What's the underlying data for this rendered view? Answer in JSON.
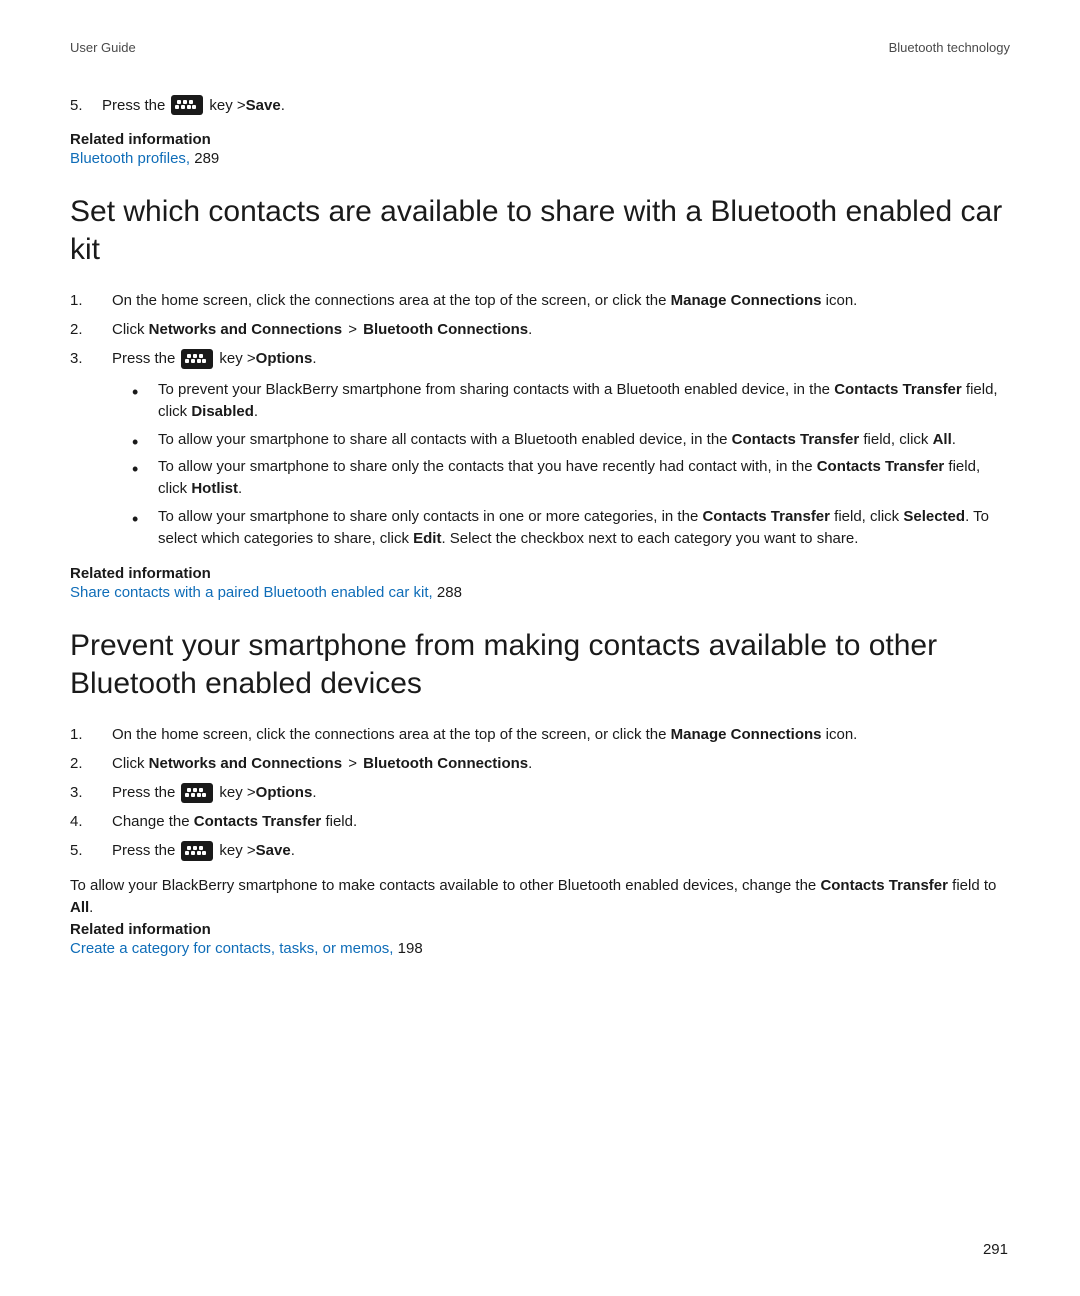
{
  "header": {
    "left": "User Guide",
    "right": "Bluetooth technology"
  },
  "intro_step": {
    "num": "5.",
    "prefix": "Press the ",
    "key_gt": " key > ",
    "action": "Save",
    "period": "."
  },
  "related1": {
    "heading": "Related information",
    "link": "Bluetooth profiles, ",
    "page": "289"
  },
  "section1": {
    "title": "Set which contacts are available to share with a Bluetooth enabled car kit",
    "steps": {
      "s1": {
        "num": "1.",
        "pre": "On the home screen, click the connections area at the top of the screen, or click the ",
        "b1": "Manage Connections",
        "post": " icon."
      },
      "s2": {
        "num": "2.",
        "pre": "Click ",
        "b1": "Networks and Connections",
        "gt": " > ",
        "b2": "Bluetooth Connections",
        "post": "."
      },
      "s3": {
        "num": "3.",
        "pre": "Press the ",
        "key_gt": " key > ",
        "b1": "Options",
        "post": "."
      }
    },
    "bullets": {
      "b1": {
        "pre": "To prevent your BlackBerry smartphone from sharing contacts with a Bluetooth enabled device, in the ",
        "t1": "Contacts Transfer",
        "mid": " field, click ",
        "t2": "Disabled",
        "post": "."
      },
      "b2": {
        "pre": "To allow your smartphone to share all contacts with a Bluetooth enabled device, in the ",
        "t1": "Contacts Transfer",
        "mid": " field, click ",
        "t2": "All",
        "post": "."
      },
      "b3": {
        "pre": "To allow your smartphone to share only the contacts that you have recently had contact with, in the ",
        "t1": "Contacts Transfer",
        "mid": " field, click ",
        "t2": "Hotlist",
        "post": "."
      },
      "b4": {
        "pre": "To allow your smartphone to share only contacts in one or more categories, in the ",
        "t1": "Contacts Transfer",
        "mid1": " field, click ",
        "t2": "Selected",
        "mid2": ". To select which categories to share, click ",
        "t3": "Edit",
        "post": ". Select the checkbox next to each category you want to share."
      }
    },
    "related": {
      "heading": "Related information",
      "link": "Share contacts with a paired Bluetooth enabled car kit, ",
      "page": "288"
    }
  },
  "section2": {
    "title": "Prevent your smartphone from making contacts available to other Bluetooth enabled devices",
    "steps": {
      "s1": {
        "num": "1.",
        "pre": "On the home screen, click the connections area at the top of the screen, or click the ",
        "b1": "Manage Connections",
        "post": " icon."
      },
      "s2": {
        "num": "2.",
        "pre": "Click ",
        "b1": "Networks and Connections",
        "gt": " > ",
        "b2": "Bluetooth Connections",
        "post": "."
      },
      "s3": {
        "num": "3.",
        "pre": "Press the ",
        "key_gt": " key > ",
        "b1": "Options",
        "post": "."
      },
      "s4": {
        "num": "4.",
        "pre": "Change the ",
        "b1": "Contacts Transfer",
        "post": " field."
      },
      "s5": {
        "num": "5.",
        "pre": "Press the ",
        "key_gt": " key > ",
        "b1": "Save",
        "post": "."
      }
    },
    "para": {
      "pre": "To allow your BlackBerry smartphone to make contacts available to other Bluetooth enabled devices, change the ",
      "t1": "Contacts Transfer",
      "mid": " field to ",
      "t2": "All",
      "post": "."
    },
    "related": {
      "heading": "Related information",
      "link": "Create a category for contacts, tasks, or memos, ",
      "page": "198"
    }
  },
  "page_number": "291"
}
